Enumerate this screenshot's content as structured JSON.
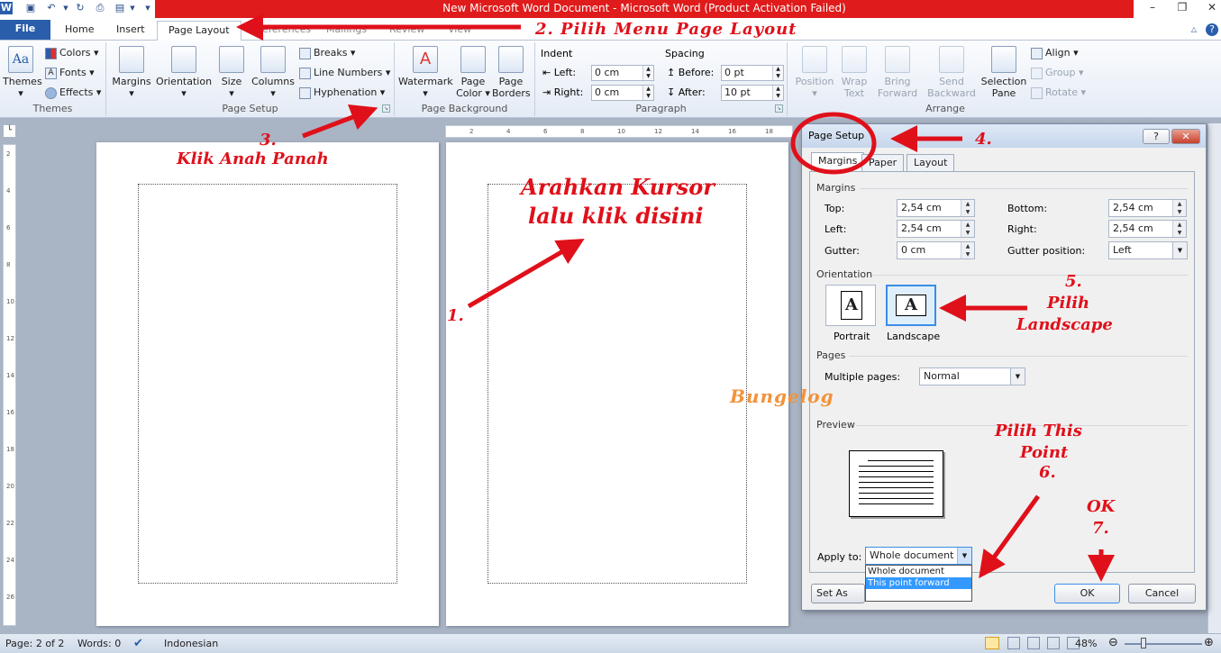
{
  "title_bar": {
    "title": "New Microsoft Word Document - Microsoft Word (Product Activation Failed)"
  },
  "ribbon_tabs": {
    "file": "File",
    "home": "Home",
    "insert": "Insert",
    "page_layout": "Page Layout",
    "references": "References",
    "mailings": "Mailings",
    "review": "Review",
    "view": "View"
  },
  "ribbon": {
    "themes": {
      "themes_label": "Themes",
      "colors": "Colors",
      "fonts": "Fonts",
      "effects": "Effects",
      "group": "Themes"
    },
    "page_setup": {
      "margins": "Margins",
      "orientation": "Orientation",
      "size": "Size",
      "columns": "Columns",
      "breaks": "Breaks",
      "line_numbers": "Line Numbers",
      "hyphenation": "Hyphenation",
      "group": "Page Setup"
    },
    "page_background": {
      "watermark": "Watermark",
      "page_color": "Page Color",
      "page_borders": "Page Borders",
      "group": "Page Background"
    },
    "paragraph": {
      "indent": "Indent",
      "left_label": "Left:",
      "left_value": "0 cm",
      "right_label": "Right:",
      "right_value": "0 cm",
      "spacing": "Spacing",
      "before_label": "Before:",
      "before_value": "0 pt",
      "after_label": "After:",
      "after_value": "10 pt",
      "group": "Paragraph"
    },
    "arrange": {
      "position": "Position",
      "wrap_text": "Wrap Text",
      "bring_forward": "Bring Forward",
      "send_backward": "Send Backward",
      "selection_pane": "Selection Pane",
      "align": "Align",
      "group_btn": "Group",
      "rotate": "Rotate",
      "group": "Arrange"
    }
  },
  "ruler": {
    "ticks": [
      "2",
      "4",
      "6",
      "8",
      "10",
      "12",
      "14",
      "16",
      "18"
    ],
    "vticks": [
      "2",
      "4",
      "6",
      "8",
      "10",
      "12",
      "14",
      "16",
      "18",
      "20",
      "22",
      "24",
      "26"
    ]
  },
  "dialog": {
    "title": "Page Setup",
    "help": "?",
    "close": "✕",
    "tabs": [
      "Margins",
      "Paper",
      "Layout"
    ],
    "margins_section": "Margins",
    "top_label": "Top:",
    "top_value": "2,54 cm",
    "bottom_label": "Bottom:",
    "bottom_value": "2,54 cm",
    "left_label": "Left:",
    "left_value": "2,54 cm",
    "right_label": "Right:",
    "right_value": "2,54 cm",
    "gutter_label": "Gutter:",
    "gutter_value": "0 cm",
    "gutter_pos_label": "Gutter position:",
    "gutter_pos_value": "Left",
    "orientation_section": "Orientation",
    "portrait": "Portrait",
    "landscape": "Landscape",
    "sheet_letter": "A",
    "pages_section": "Pages",
    "multiple_pages_label": "Multiple pages:",
    "multiple_pages_value": "Normal",
    "preview_section": "Preview",
    "apply_to_label": "Apply to:",
    "apply_to_value": "Whole document",
    "apply_options": [
      "Whole document",
      "This point forward"
    ],
    "set_as_default": "Set As Defa",
    "ok": "OK",
    "cancel": "Cancel"
  },
  "status_bar": {
    "page": "Page: 2 of 2",
    "words": "Words: 0",
    "language": "Indonesian",
    "zoom": "48%"
  },
  "annotations": {
    "step2": "2. Pilih Menu Page Layout",
    "step3a": "3.",
    "step3b": "Klik Anah Panah",
    "step1": "1.",
    "cursor1": "Arahkan Kursor",
    "cursor2": "lalu klik disini",
    "step4": "4.",
    "step5a": "5.",
    "step5b": "Pilih",
    "step5c": "Landscape",
    "step6a": "Pilih This",
    "step6b": "Point",
    "step6c": "6.",
    "step7a": "OK",
    "step7b": "7.",
    "watermark": "Bungelog"
  },
  "colors": {
    "annotation_red": "#e0101a",
    "title_red": "#e01b1b",
    "file_tab_blue": "#2a5eab",
    "watermark_orange": "#f2923a"
  }
}
